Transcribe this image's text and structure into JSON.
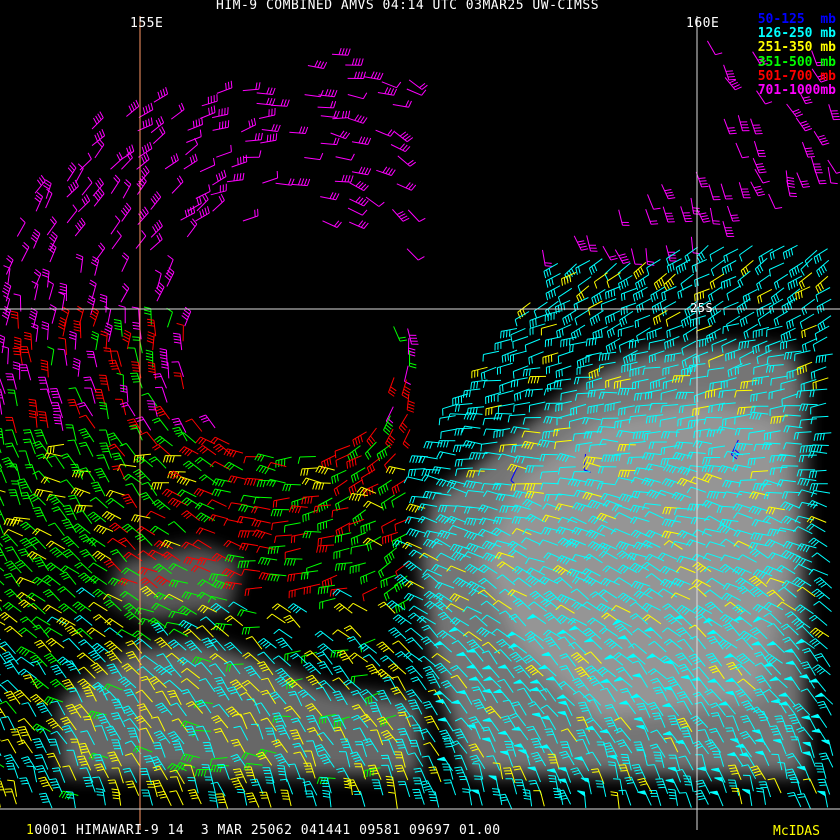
{
  "title": "HIM-9 COMBINED AMVS 04:14 UTC 03MAR25 UW-CIMSS",
  "grid_labels": {
    "lon_155": "155E",
    "lon_160": "160E",
    "lat_25": "25S"
  },
  "legend": [
    {
      "label": "50-125  mb",
      "color": "#0000ff"
    },
    {
      "label": "126-250 mb",
      "color": "#00ffff"
    },
    {
      "label": "251-350 mb",
      "color": "#ffff00"
    },
    {
      "label": "351-500 mb",
      "color": "#00ff00"
    },
    {
      "label": "501-700 mb",
      "color": "#ff0000"
    },
    {
      "label": "701-1000mb",
      "color": "#ff00ff"
    }
  ],
  "footer": {
    "prefix": "1",
    "text": "0001 HIMAWARI-9 14  3 MAR 25062 041441 09581 09697 01.00",
    "brand": "McIDAS"
  },
  "colors": {
    "grid_155": "#ff9966",
    "grid": "#dddddd",
    "cloud": "#9a9a9a"
  }
}
